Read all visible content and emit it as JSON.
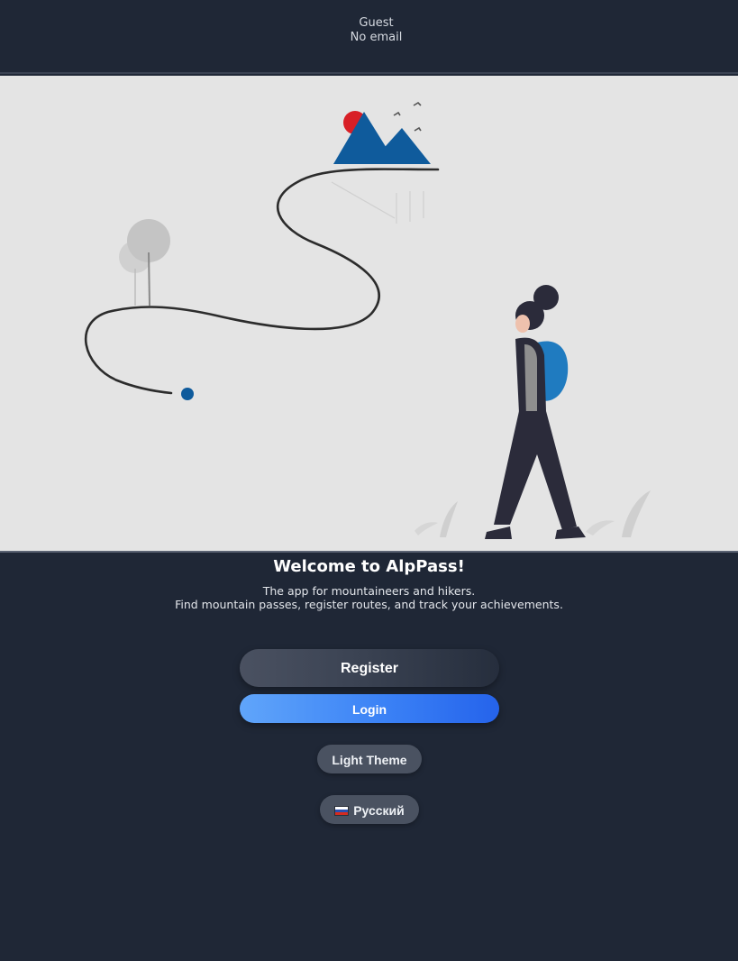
{
  "header": {
    "user_name": "Guest",
    "user_email": "No email"
  },
  "hero": {
    "illustration": "hiker-with-mountain-trail-illustration",
    "colors": {
      "background": "#e4e4e4",
      "accent": "#0f5b9c",
      "sun": "#d81f26",
      "figure": "#2b2b3a"
    }
  },
  "welcome": {
    "title": "Welcome to AlpPass!",
    "subtitle_line1": "The app for mountaineers and hikers.",
    "subtitle_line2": "Find mountain passes, register routes, and track your achievements."
  },
  "actions": {
    "register_label": "Register",
    "login_label": "Login",
    "theme_label": "Light Theme",
    "language_label": "Русский",
    "language_flag": "russian-flag-icon"
  },
  "colors": {
    "page_background": "#1f2736",
    "login_gradient_start": "#60a5fa",
    "login_gradient_end": "#2563eb"
  }
}
